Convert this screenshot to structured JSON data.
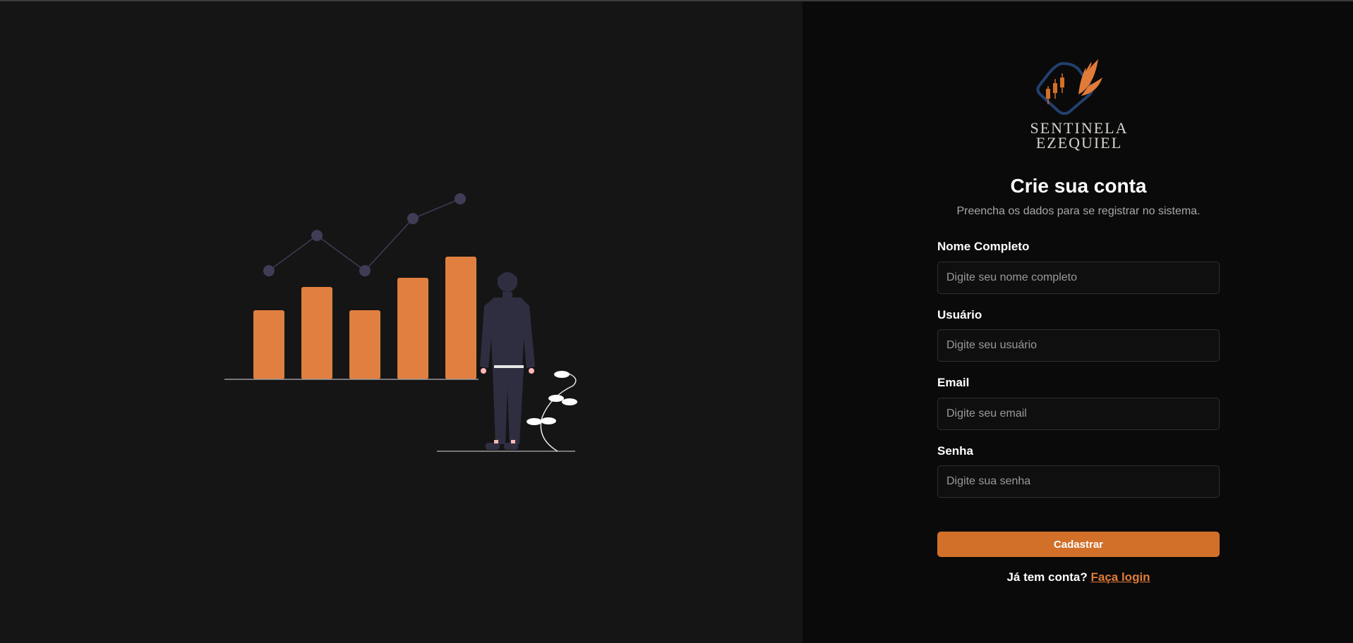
{
  "brand": {
    "name_line1": "SENTINELA",
    "name_line2": "EZEQUIEL",
    "colors": {
      "blue": "#23406e",
      "orange": "#e07b39"
    }
  },
  "illustration": {
    "icon": "chart-growth-person-illustration",
    "bar_color": "#e07f3f",
    "bar_levels": [
      0.36,
      0.48,
      0.36,
      0.53,
      0.64
    ]
  },
  "form": {
    "title": "Crie sua conta",
    "subtitle": "Preencha os dados para se registrar no sistema.",
    "fields": [
      {
        "label": "Nome Completo",
        "placeholder": "Digite seu nome completo",
        "value": "",
        "type": "text"
      },
      {
        "label": "Usuário",
        "placeholder": "Digite seu usuário",
        "value": "",
        "type": "text"
      },
      {
        "label": "Email",
        "placeholder": "Digite seu email",
        "value": "",
        "type": "email"
      },
      {
        "label": "Senha",
        "placeholder": "Digite sua senha",
        "value": "",
        "type": "password"
      }
    ],
    "submit_label": "Cadastrar",
    "login_prompt": "Já tem conta?",
    "login_link": "Faça login",
    "accent_color": "#d2702a"
  }
}
